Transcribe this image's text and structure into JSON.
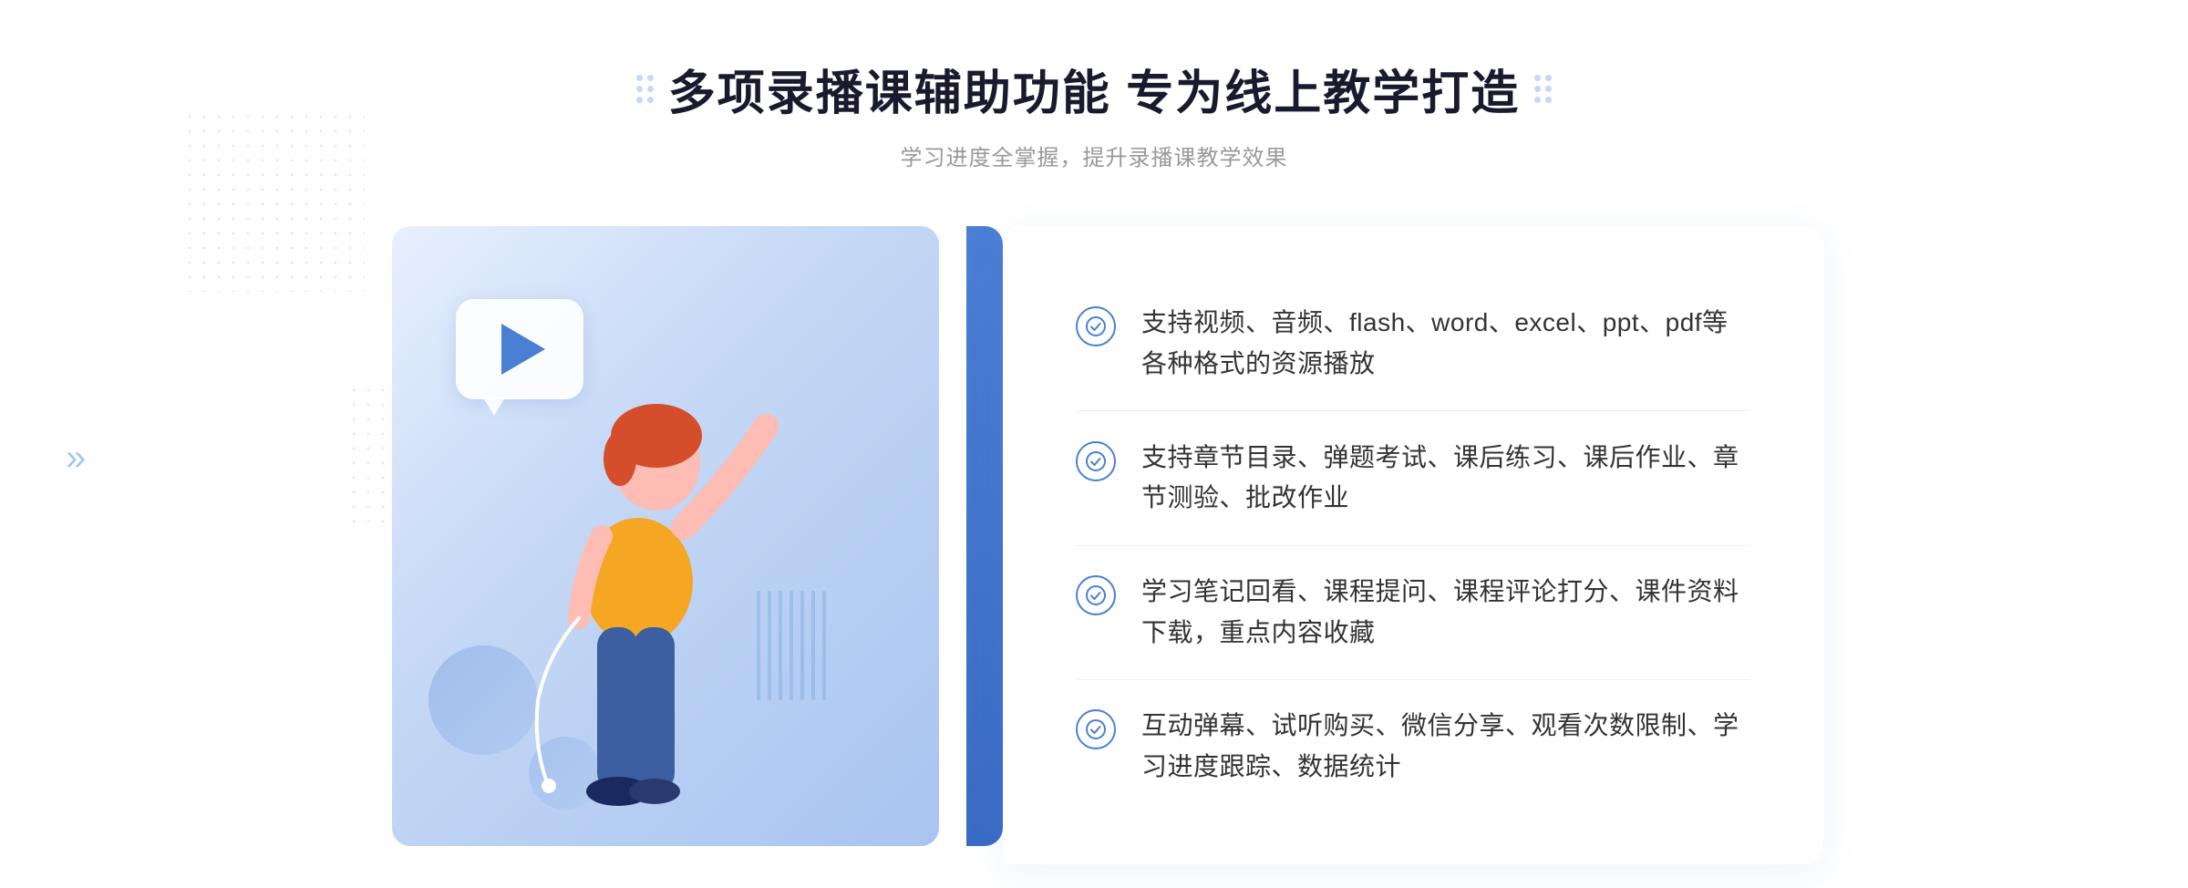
{
  "header": {
    "title": "多项录播课辅助功能 专为线上教学打造",
    "subtitle": "学习进度全掌握，提升录播课教学效果",
    "dots_left": true,
    "dots_right": true
  },
  "features": [
    {
      "id": 1,
      "text": "支持视频、音频、flash、word、excel、ppt、pdf等各种格式的资源播放"
    },
    {
      "id": 2,
      "text": "支持章节目录、弹题考试、课后练习、课后作业、章节测验、批改作业"
    },
    {
      "id": 3,
      "text": "学习笔记回看、课程提问、课程评论打分、课件资料下载，重点内容收藏"
    },
    {
      "id": 4,
      "text": "互动弹幕、试听购买、微信分享、观看次数限制、学习进度跟踪、数据统计"
    }
  ],
  "colors": {
    "primary": "#4a7fd4",
    "title": "#1a1a2e",
    "text": "#333333",
    "subtitle": "#999999",
    "bg_light": "#e8f0fe",
    "border": "#f0f0f0"
  },
  "icons": {
    "check": "✓",
    "play": "▶",
    "chevron": "»"
  }
}
